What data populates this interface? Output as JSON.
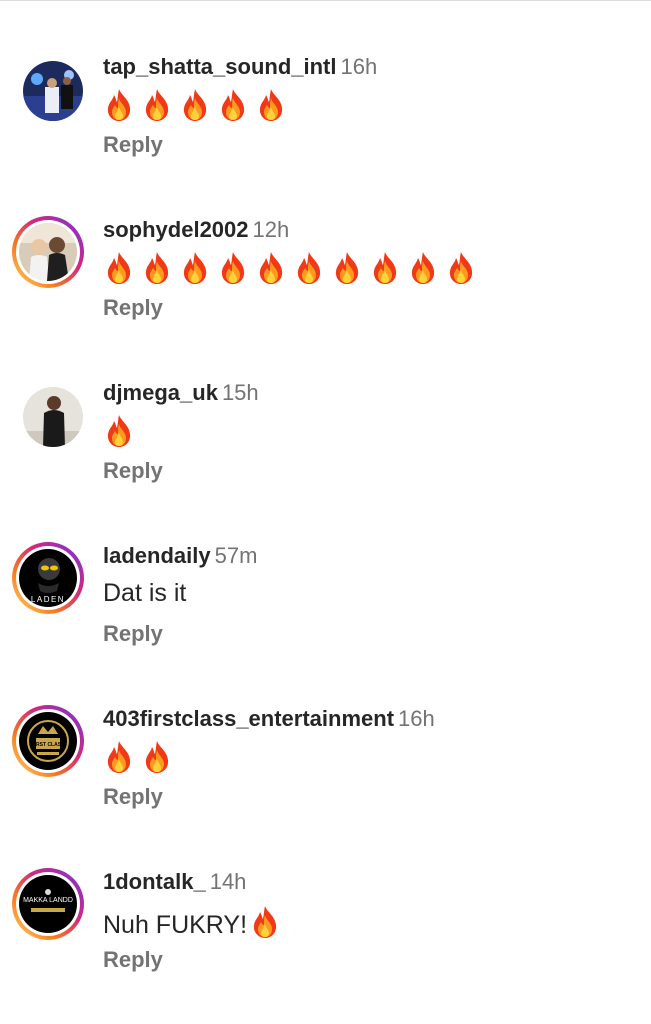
{
  "comments": [
    {
      "username": "tap_shatta_sound_intl",
      "time": "16h",
      "fires": 5,
      "text": "",
      "reply": "Reply"
    },
    {
      "username": "sophydel2002",
      "time": "12h",
      "fires": 10,
      "text": "",
      "reply": "Reply"
    },
    {
      "username": "djmega_uk",
      "time": "15h",
      "fires": 1,
      "text": "",
      "reply": "Reply"
    },
    {
      "username": "ladendaily",
      "time": "57m",
      "fires": 0,
      "text": "Dat is it",
      "reply": "Reply",
      "avatar_logo_text": "LADEN"
    },
    {
      "username": "403firstclass_entertainment",
      "time": "16h",
      "fires": 2,
      "text": "",
      "reply": "Reply",
      "avatar_logo_text": "FIRST CLASS"
    },
    {
      "username": "1dontalk_",
      "time": "14h",
      "fires": 0,
      "text": "Nuh FUKRY!",
      "reply": "Reply",
      "trailing_emoji": "fire",
      "avatar_logo_text": "MAKKA LANDD"
    }
  ],
  "colors": {
    "username": "#262626",
    "secondary": "#737373",
    "story_ring": [
      "#feda75",
      "#fa7e1e",
      "#d62976",
      "#962fbf"
    ]
  }
}
